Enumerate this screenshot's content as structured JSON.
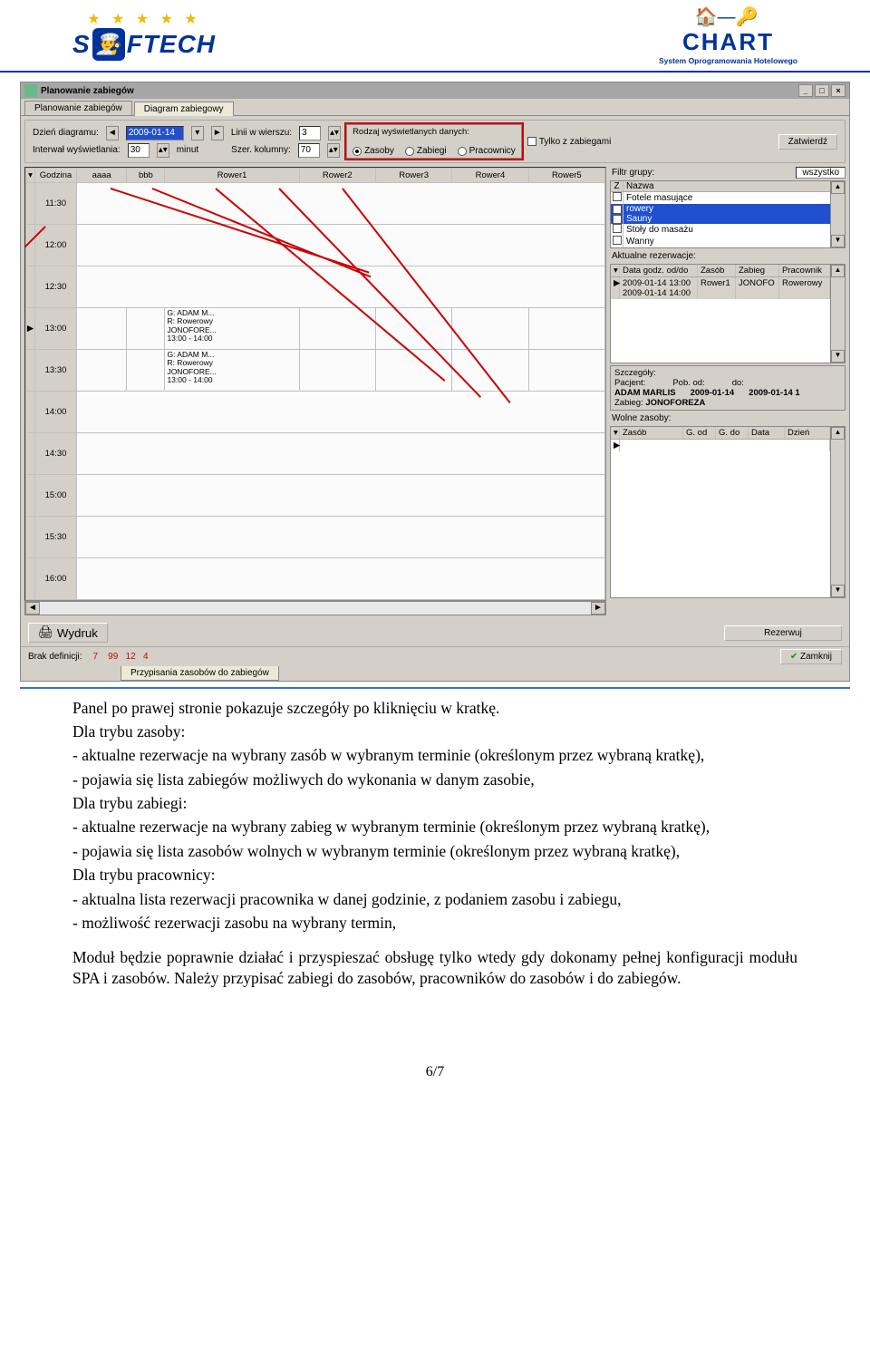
{
  "header": {
    "leftLogoText": "S  FTECH",
    "rightLogoText": "CHART",
    "rightSub": "System Oprogramowania Hotelowego"
  },
  "win": {
    "title": "Planowanie zabiegów",
    "tabs": [
      "Planowanie zabiegów",
      "Diagram zabiegowy"
    ],
    "activeTab": 1
  },
  "toolbar": {
    "dayLabel": "Dzień diagramu:",
    "dayValue": "2009-01-14",
    "linesLabel": "Linii w wierszu:",
    "linesValue": "3",
    "intervalLabel": "Interwał wyświetlania:",
    "intervalValue": "30",
    "intervalUnit": "minut",
    "colLabel": "Szer. kolumny:",
    "colValue": "70",
    "groupTitle": "Rodzaj wyświetlanych danych:",
    "radios": [
      "Zasoby",
      "Zabiegi",
      "Pracownicy"
    ],
    "radioSelected": 0,
    "onlyWithLabel": "Tylko z zabiegami",
    "confirm": "Zatwierdź"
  },
  "grid": {
    "cols": [
      "Godzina",
      "aaaa",
      "bbb",
      "Rower1",
      "Rower2",
      "Rower3",
      "Rower4",
      "Rower5"
    ],
    "times": [
      "11:30",
      "12:00",
      "12:30",
      "13:00",
      "13:30",
      "14:00",
      "14:30",
      "15:00",
      "15:30",
      "16:00"
    ],
    "cell1300": "G: ADAM M...\nR: Rowerowy\nJONOFORE...\n13:00 - 14:00",
    "cell1330": "G: ADAM M...\nR: Rowerowy\nJONOFORE...\n13:00 - 14:00"
  },
  "filter": {
    "title": "Filtr grupy:",
    "all": "wszystko",
    "cols": [
      "Z",
      "Nazwa"
    ],
    "rows": [
      {
        "checked": false,
        "name": "Fotele masujące",
        "sel": false
      },
      {
        "checked": true,
        "name": "rowery",
        "sel": true
      },
      {
        "checked": true,
        "name": "Sauny",
        "sel": true
      },
      {
        "checked": false,
        "name": "Stoły do masażu",
        "sel": false
      },
      {
        "checked": false,
        "name": "Wanny",
        "sel": false
      }
    ]
  },
  "reservations": {
    "title": "Aktualne rezerwacje:",
    "cols": [
      "Data godz. od/do",
      "Zasób",
      "Zabieg",
      "Pracownik"
    ],
    "row": {
      "dates": "2009-01-14 13:00\n2009-01-14 14:00",
      "zasob": "Rower1",
      "zabieg": "JONOFO",
      "prac": "Rowerowy"
    }
  },
  "details": {
    "title": "Szczegóły:",
    "pacLabel": "Pacjent:",
    "pacjent": "ADAM MARLIS",
    "pobLabel": "Pob. od:",
    "doLabel": "do:",
    "od": "2009-01-14",
    "do": "2009-01-14 1",
    "zabiegLabel": "Zabieg:",
    "zabieg": "JONOFOREZA"
  },
  "free": {
    "title": "Wolne zasoby:",
    "cols": [
      "Zasób",
      "G. od",
      "G. do",
      "Data",
      "Dzień"
    ]
  },
  "buttons": {
    "print": "Wydruk",
    "reserve": "Rezerwuj",
    "close": "Zamknij"
  },
  "status": {
    "label": "Brak definicji:",
    "nums": "7    99   12   4",
    "assign": "Przypisania zasobów do zabiegów"
  },
  "text": {
    "p1": "Panel po prawej stronie pokazuje szczegóły po kliknięciu w kratkę.",
    "p2": "Dla trybu zasoby:",
    "p3": "- aktualne rezerwacje na wybrany zasób w wybranym terminie (określonym przez wybraną kratkę),",
    "p4": "- pojawia się lista zabiegów możliwych do wykonania w danym zasobie,",
    "p5": "Dla trybu zabiegi:",
    "p6": "- aktualne rezerwacje na wybrany zabieg w wybranym terminie (określonym przez wybraną kratkę),",
    "p7": "- pojawia się lista zasobów wolnych w wybranym terminie (określonym przez wybraną kratkę),",
    "p8": "Dla trybu pracownicy:",
    "p9": "- aktualna lista rezerwacji pracownika w danej godzinie, z podaniem zasobu i zabiegu,",
    "p10": "- możliwość rezerwacji zasobu na wybrany termin,",
    "p11": "Moduł będzie poprawnie działać i przyspieszać obsługę tylko wtedy gdy dokonamy pełnej konfiguracji modułu SPA i zasobów. Należy przypisać zabiegi do zasobów, pracowników do zasobów i do zabiegów."
  },
  "footer": "6/7"
}
